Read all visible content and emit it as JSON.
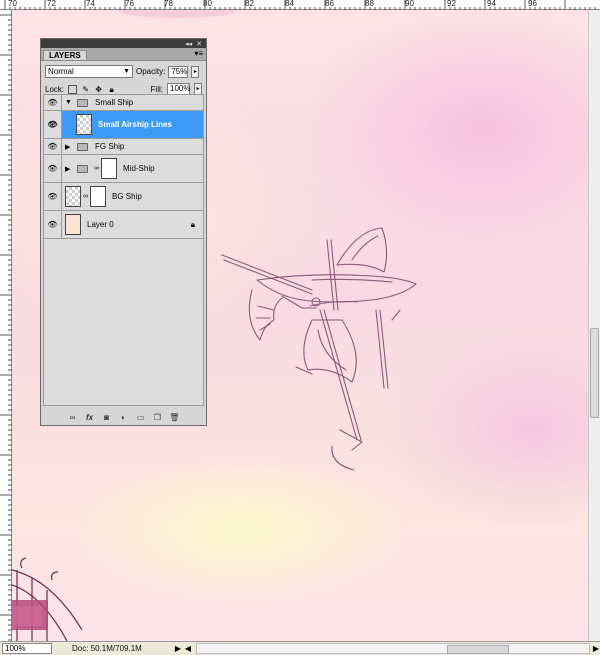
{
  "rulers": {
    "top_labels": [
      "70",
      "72",
      "74",
      "76",
      "78",
      "80",
      "82",
      "84",
      "86",
      "88",
      "90",
      "92",
      "94",
      "96"
    ]
  },
  "layers_panel": {
    "tab": "LAYERS",
    "blend_mode": "Normal",
    "opacity_label": "Opacity:",
    "opacity_value": "75%",
    "lock_label": "Lock:",
    "fill_label": "Fill:",
    "fill_value": "100%",
    "layers": [
      {
        "name": "Small Ship",
        "type": "group",
        "expanded": true
      },
      {
        "name": "Small Airship Lines",
        "type": "layer",
        "selected": true
      },
      {
        "name": "FG Ship",
        "type": "group",
        "expanded": false
      },
      {
        "name": "Mid-Ship",
        "type": "group-masked",
        "expanded": false
      },
      {
        "name": "BG Ship",
        "type": "layer-masked"
      },
      {
        "name": "Layer 0",
        "type": "background",
        "locked": true
      }
    ]
  },
  "status_bar": {
    "zoom": "100%",
    "doc_info": "Doc: 50.1M/709.1M"
  }
}
